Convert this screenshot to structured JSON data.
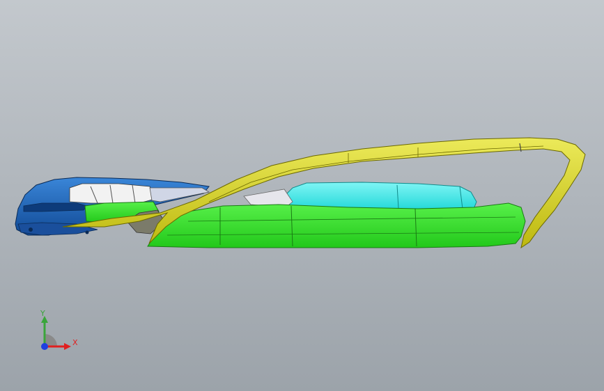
{
  "viewport": {
    "background_top": "#c3c8cd",
    "background_bottom": "#9ca3aa"
  },
  "model": {
    "parts": [
      {
        "name": "front-body-part",
        "color": "#1f63b8"
      },
      {
        "name": "green-body-part",
        "color": "#33e02a"
      },
      {
        "name": "cyan-body-part",
        "color": "#35e8e8"
      },
      {
        "name": "yellow-frame-part",
        "color": "#d7d31d"
      }
    ]
  },
  "triad": {
    "y_label": "Y",
    "x_label": "X",
    "y_color": "#3aa53a",
    "x_color": "#e02020",
    "z_color": "#2040e0"
  }
}
